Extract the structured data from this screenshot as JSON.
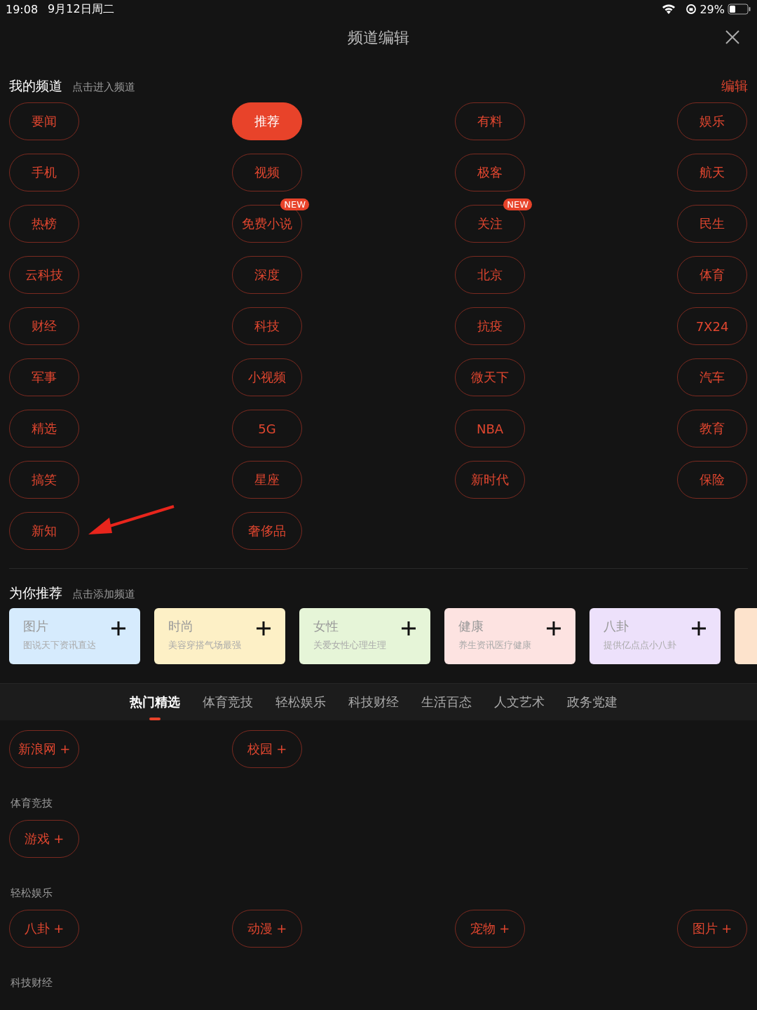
{
  "status_bar": {
    "time": "19:08",
    "date": "9月12日周二",
    "battery": "29%"
  },
  "header": {
    "title": "频道编辑"
  },
  "my_channels": {
    "title": "我的频道",
    "hint": "点击进入频道",
    "edit": "编辑",
    "items": [
      {
        "label": "要闻",
        "selected": false
      },
      {
        "label": "推荐",
        "selected": true
      },
      {
        "label": "有料",
        "selected": false
      },
      {
        "label": "娱乐",
        "selected": false
      },
      {
        "label": "手机",
        "selected": false
      },
      {
        "label": "视频",
        "selected": false
      },
      {
        "label": "极客",
        "selected": false
      },
      {
        "label": "航天",
        "selected": false
      },
      {
        "label": "热榜",
        "selected": false
      },
      {
        "label": "免费小说",
        "selected": false,
        "badge": "NEW"
      },
      {
        "label": "关注",
        "selected": false,
        "badge": "NEW"
      },
      {
        "label": "民生",
        "selected": false
      },
      {
        "label": "云科技",
        "selected": false
      },
      {
        "label": "深度",
        "selected": false
      },
      {
        "label": "北京",
        "selected": false
      },
      {
        "label": "体育",
        "selected": false
      },
      {
        "label": "财经",
        "selected": false
      },
      {
        "label": "科技",
        "selected": false
      },
      {
        "label": "抗疫",
        "selected": false
      },
      {
        "label": "7X24",
        "selected": false
      },
      {
        "label": "军事",
        "selected": false
      },
      {
        "label": "小视频",
        "selected": false
      },
      {
        "label": "微天下",
        "selected": false
      },
      {
        "label": "汽车",
        "selected": false
      },
      {
        "label": "精选",
        "selected": false
      },
      {
        "label": "5G",
        "selected": false
      },
      {
        "label": "NBA",
        "selected": false
      },
      {
        "label": "教育",
        "selected": false
      },
      {
        "label": "搞笑",
        "selected": false
      },
      {
        "label": "星座",
        "selected": false
      },
      {
        "label": "新时代",
        "selected": false
      },
      {
        "label": "保险",
        "selected": false
      },
      {
        "label": "新知",
        "selected": false
      },
      {
        "label": "奢侈品",
        "selected": false
      }
    ]
  },
  "recommended": {
    "title": "为你推荐",
    "hint": "点击添加频道",
    "cards": [
      {
        "title": "图片",
        "subtitle": "图说天下资讯直达",
        "color": "#d6ebfd"
      },
      {
        "title": "时尚",
        "subtitle": "美容穿搭气场最强",
        "color": "#fdf0c6"
      },
      {
        "title": "女性",
        "subtitle": "关爱女性心理生理",
        "color": "#e6f5d8"
      },
      {
        "title": "健康",
        "subtitle": "养生资讯医疗健康",
        "color": "#fde3e1"
      },
      {
        "title": "八卦",
        "subtitle": "提供亿点点小八卦",
        "color": "#ede1fb"
      },
      {
        "color": "#fde3cc"
      }
    ]
  },
  "category_tabs": [
    {
      "label": "热门精选",
      "selected": true
    },
    {
      "label": "体育竞技",
      "selected": false
    },
    {
      "label": "轻松娱乐",
      "selected": false
    },
    {
      "label": "科技财经",
      "selected": false
    },
    {
      "label": "生活百态",
      "selected": false
    },
    {
      "label": "人文艺术",
      "selected": false
    },
    {
      "label": "政务党建",
      "selected": false
    }
  ],
  "categories": [
    {
      "items": [
        "新浪网 +",
        "校园 +"
      ]
    },
    {
      "heading": "体育竞技",
      "items": [
        "游戏 +"
      ]
    },
    {
      "heading": "轻松娱乐",
      "items": [
        "八卦 +",
        "动漫 +",
        "宠物 +",
        "图片 +"
      ]
    },
    {
      "heading": "科技财经"
    }
  ]
}
